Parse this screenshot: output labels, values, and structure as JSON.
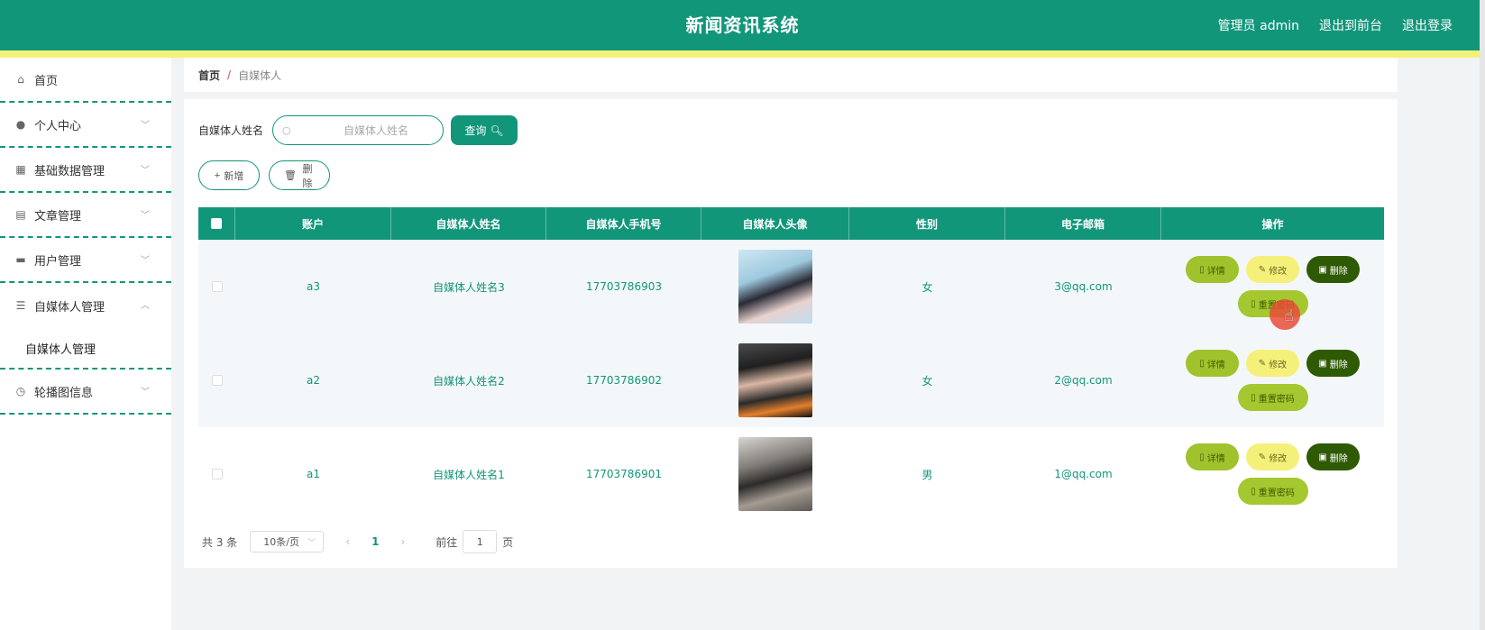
{
  "header": {
    "title": "新闻资讯系统",
    "admin_label": "管理员 admin",
    "to_front": "退出到前台",
    "logout": "退出登录"
  },
  "sidebar": {
    "items": [
      {
        "label": "首页",
        "icon": "home-icon"
      },
      {
        "label": "个人中心",
        "icon": "user-icon"
      },
      {
        "label": "基础数据管理",
        "icon": "grid-icon"
      },
      {
        "label": "文章管理",
        "icon": "clipboard-icon"
      },
      {
        "label": "用户管理",
        "icon": "monitor-icon"
      },
      {
        "label": "自媒体人管理",
        "icon": "list-icon"
      },
      {
        "label": "轮播图信息",
        "icon": "clock-icon"
      }
    ],
    "sub_item": "自媒体人管理"
  },
  "breadcrumb": {
    "home": "首页",
    "sep": "/",
    "current": "自媒体人"
  },
  "search": {
    "label": "自媒体人姓名",
    "placeholder": "自媒体人姓名",
    "query_button": "查询"
  },
  "actions": {
    "add": "新增",
    "delete": "删除"
  },
  "table": {
    "headers": [
      "账户",
      "自媒体人姓名",
      "自媒体人手机号",
      "自媒体人头像",
      "性别",
      "电子邮箱",
      "操作"
    ],
    "rows": [
      {
        "account": "a3",
        "name": "自媒体人姓名3",
        "phone": "17703786903",
        "gender": "女",
        "email": "3@qq.com"
      },
      {
        "account": "a2",
        "name": "自媒体人姓名2",
        "phone": "17703786902",
        "gender": "女",
        "email": "2@qq.com"
      },
      {
        "account": "a1",
        "name": "自媒体人姓名1",
        "phone": "17703786901",
        "gender": "男",
        "email": "1@qq.com"
      }
    ],
    "ops": {
      "detail": "详情",
      "edit": "修改",
      "delete": "删除",
      "reset": "重置密码"
    }
  },
  "pager": {
    "total": "共 3 条",
    "page_size": "10条/页",
    "current": "1",
    "jump_label": "前往",
    "jump_value": "1",
    "page_unit": "页"
  },
  "colors": {
    "primary": "#12967a",
    "stripe": "#f2f27a",
    "detail": "#9fc22d",
    "edit": "#f5f07a",
    "delete": "#2f5a04"
  }
}
